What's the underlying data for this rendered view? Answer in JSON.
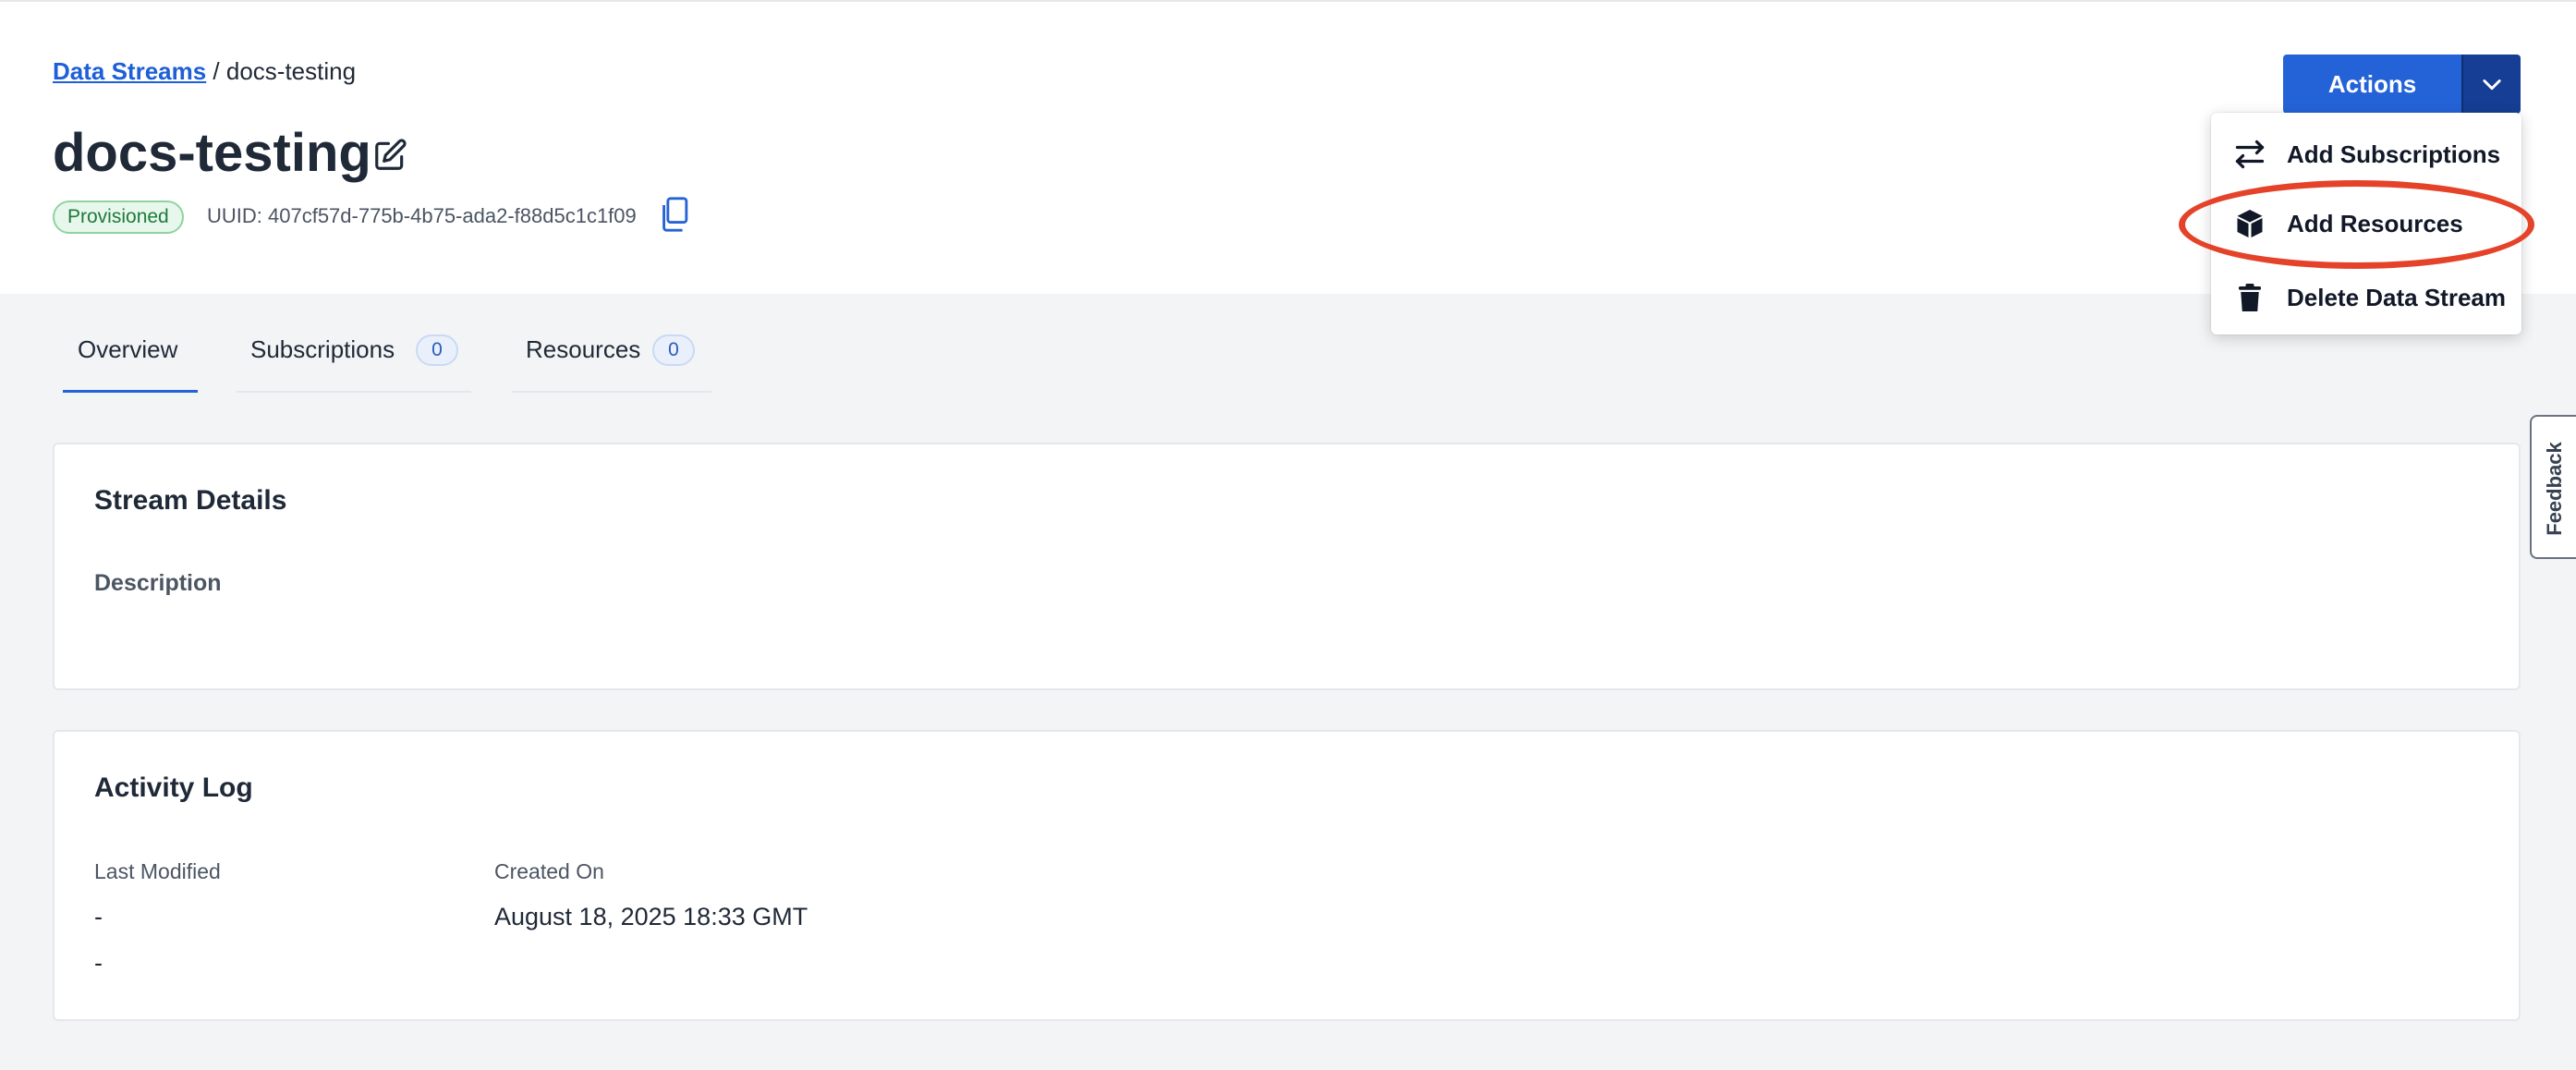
{
  "breadcrumb": {
    "parent": "Data Streams",
    "separator": " / ",
    "current": "docs-testing"
  },
  "page": {
    "title": "docs-testing"
  },
  "status_badge": "Provisioned",
  "uuid": "UUID: 407cf57d-775b-4b75-ada2-f88d5c1c1f09",
  "actions": {
    "label": "Actions",
    "menu": [
      {
        "label": "Add Subscriptions",
        "icon": "arrows-exchange-icon"
      },
      {
        "label": "Add Resources",
        "icon": "cube-icon"
      },
      {
        "label": "Delete Data Stream",
        "icon": "trash-icon"
      }
    ]
  },
  "tabs": [
    {
      "label": "Overview",
      "active": true
    },
    {
      "label": "Subscriptions",
      "count": "0"
    },
    {
      "label": "Resources",
      "count": "0"
    }
  ],
  "stream_details": {
    "title": "Stream Details",
    "description_label": "Description"
  },
  "activity_log": {
    "title": "Activity Log",
    "last_modified_label": "Last Modified",
    "created_on_label": "Created On",
    "last_modified_values": [
      "-",
      "-"
    ],
    "created_on_value": "August 18, 2025 18:33 GMT"
  },
  "feedback": "Feedback",
  "colors": {
    "primary": "#2463d7",
    "primary_dark": "#153e94",
    "highlight": "#e4432a",
    "success": "#1e7a3a"
  }
}
